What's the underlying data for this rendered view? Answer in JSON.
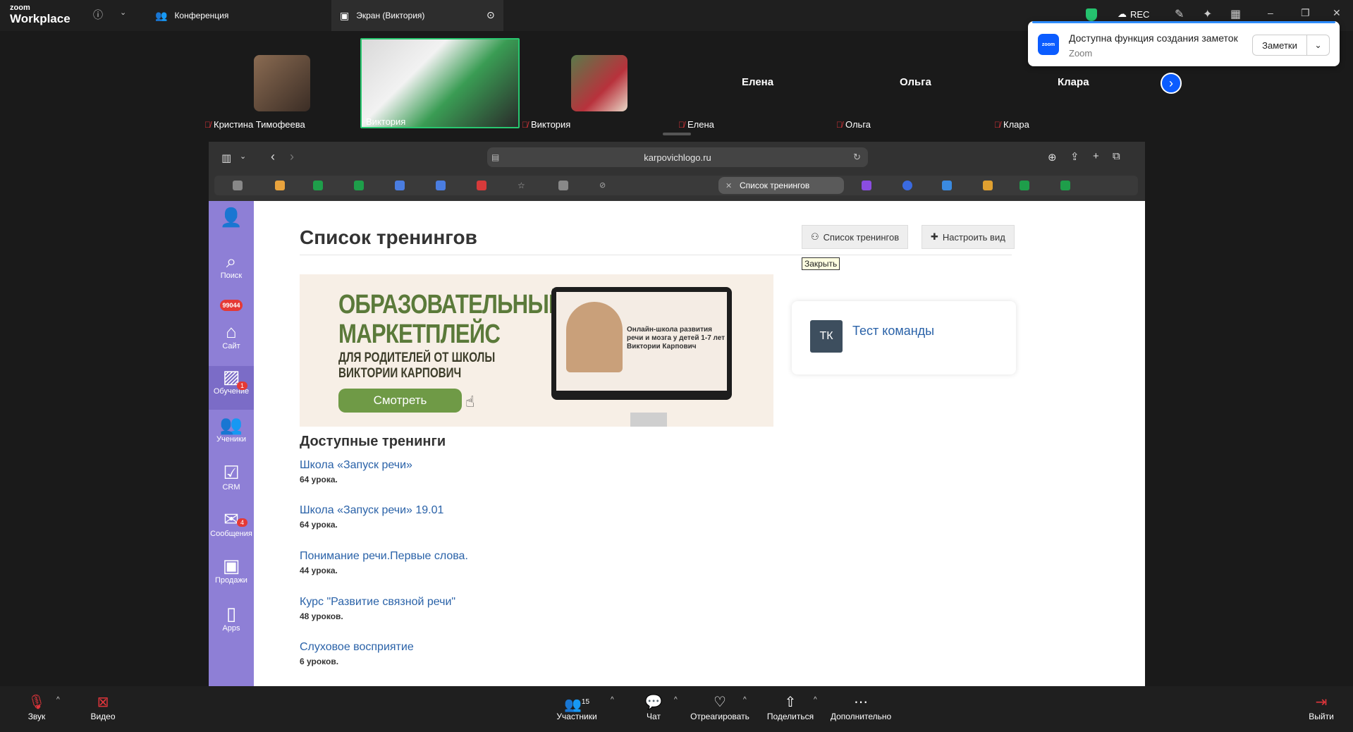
{
  "app": {
    "logo_small": "zoom",
    "logo_big": "Workplace"
  },
  "tabs": [
    {
      "label": "Конференция"
    },
    {
      "label": "Экран (Виктория)"
    }
  ],
  "recording": {
    "label": "REC"
  },
  "notification": {
    "title": "Доступна функция создания заметок",
    "source": "Zoom",
    "button": "Заметки",
    "logo_text": "zoom"
  },
  "participants": [
    {
      "name": "Кристина Тимофеева"
    },
    {
      "name": "Виктория"
    },
    {
      "name": "Виктория"
    },
    {
      "name": "Елена"
    },
    {
      "name": "Ольга"
    },
    {
      "name": "Клара"
    }
  ],
  "browser": {
    "url": "karpovichlogo.ru",
    "active_tab": "Список тренингов"
  },
  "sidebar": {
    "items": [
      {
        "label": "Поиск"
      },
      {
        "label": "Сайт"
      },
      {
        "label": "Обучение",
        "badge": "1"
      },
      {
        "label": "Ученики"
      },
      {
        "label": "CRM"
      },
      {
        "label": "Сообщения",
        "badge": "4"
      },
      {
        "label": "Продажи"
      },
      {
        "label": "Apps"
      }
    ],
    "counter": "99044"
  },
  "page": {
    "title": "Список тренингов",
    "btn_list": "Список тренингов",
    "btn_view": "Настроить вид",
    "tooltip": "Закрыть",
    "banner": {
      "headline": "ОБРАЗОВАТЕЛЬНЫЙ МАРКЕТПЛЕЙС",
      "sub1": "ДЛЯ РОДИТЕЛЕЙ ОТ ШКОЛЫ",
      "sub2": "ВИКТОРИИ КАРПОВИЧ",
      "watch": "Смотреть",
      "screen_line1": "Онлайн-школа развития",
      "screen_line2": "речи и мозга у детей 1-7 лет",
      "screen_line3": "Виктории Карпович"
    },
    "team": {
      "initials": "ТК",
      "name": "Тест команды"
    },
    "available_title": "Доступные тренинги",
    "courses": [
      {
        "name": "Школа «Запуск речи»",
        "lessons": "64 урока."
      },
      {
        "name": "Школа «Запуск речи» 19.01",
        "lessons": "64 урока."
      },
      {
        "name": "Понимание речи.Первые слова.",
        "lessons": "44 урока."
      },
      {
        "name": "Курс \"Развитие связной речи\"",
        "lessons": "48 уроков."
      },
      {
        "name": "Слуховое восприятие",
        "lessons": "6 уроков."
      }
    ]
  },
  "toolbar": {
    "audio": "Звук",
    "video": "Видео",
    "participants": "Участники",
    "participants_count": "15",
    "chat": "Чат",
    "react": "Отреагировать",
    "share": "Поделиться",
    "more": "Дополнительно",
    "leave": "Выйти"
  }
}
